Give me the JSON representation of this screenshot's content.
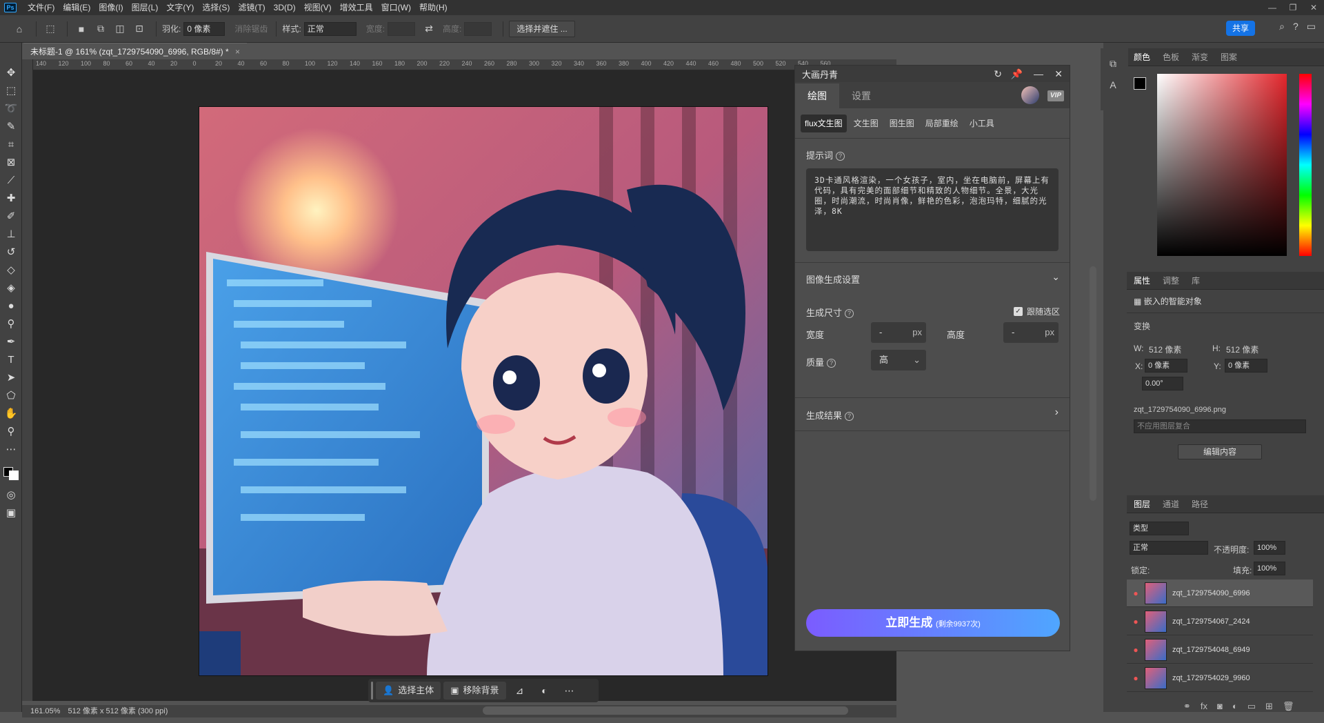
{
  "menubar": {
    "logo": "Ps",
    "items": [
      "文件(F)",
      "编辑(E)",
      "图像(I)",
      "图层(L)",
      "文字(Y)",
      "选择(S)",
      "滤镜(T)",
      "3D(D)",
      "视图(V)",
      "增效工具",
      "窗口(W)",
      "帮助(H)"
    ]
  },
  "options": {
    "feather_label": "羽化:",
    "feather_value": "0 像素",
    "antialias": "消除锯齿",
    "style_label": "样式:",
    "style_value": "正常",
    "width_label": "宽度:",
    "height_label": "高度:",
    "select_mask": "选择并遮住 ...",
    "share": "共享"
  },
  "document": {
    "tab_title": "未标题-1 @ 161% (zqt_1729754090_6996, RGB/8#) *",
    "ruler_ticks": [
      "140",
      "120",
      "100",
      "80",
      "60",
      "40",
      "20",
      "0",
      "20",
      "40",
      "60",
      "80",
      "100",
      "120",
      "140",
      "160",
      "180",
      "200",
      "220",
      "240",
      "260",
      "280",
      "300",
      "320",
      "340",
      "360",
      "380",
      "400",
      "420",
      "440",
      "460",
      "480",
      "500",
      "520",
      "540",
      "560"
    ]
  },
  "floating_bar": {
    "select_subject": "选择主体",
    "remove_bg": "移除背景"
  },
  "status": {
    "zoom": "161.05%",
    "info": "512 像素 x 512 像素 (300 ppi)"
  },
  "plugin": {
    "title": "大画丹青",
    "tabs": [
      "绘图",
      "设置"
    ],
    "vip": "VIP",
    "subtabs": [
      "flux文生图",
      "文生图",
      "图生图",
      "局部重绘",
      "小工具"
    ],
    "prompt_label": "提示词",
    "prompt_text": "3D卡通风格渲染，一个女孩子，室内，坐在电脑前，屏幕上有代码，具有完美的面部细节和精致的人物细节。全景，大光圈，时尚潮流，时尚肖像，鲜艳的色彩，泡泡玛特，细腻的光泽，8K",
    "image_settings": "图像生成设置",
    "size_label": "生成尺寸",
    "follow_selection": "跟随选区",
    "width_label": "宽度",
    "height_label": "高度",
    "width_value": "-",
    "height_value": "-",
    "unit": "px",
    "quality_label": "质量",
    "quality_value": "高",
    "results_label": "生成结果",
    "generate": "立即生成",
    "generate_remaining": "(剩余9937次)"
  },
  "right_panel": {
    "color_tabs": [
      "颜色",
      "色板",
      "渐变",
      "图案"
    ],
    "props_tabs": [
      "属性",
      "调整",
      "库"
    ],
    "smart_object": "嵌入的智能对象",
    "transform": "变换",
    "w_label": "W:",
    "w_value": "512 像素",
    "h_label": "H:",
    "h_value": "512 像素",
    "x_label": "X:",
    "x_value": "0 像素",
    "y_label": "Y:",
    "y_value": "0 像素",
    "angle": "0.00°",
    "filename": "zqt_1729754090_6996.png",
    "layer_comp": "不应用图层复合",
    "edit_contents": "编辑内容",
    "layer_tabs": [
      "图层",
      "通道",
      "路径"
    ],
    "kind": "类型",
    "blend": "正常",
    "opacity_label": "不透明度:",
    "opacity": "100%",
    "lock_label": "锁定:",
    "fill_label": "填充:",
    "fill": "100%",
    "layers": [
      "zqt_1729754090_6996",
      "zqt_1729754067_2424",
      "zqt_1729754048_6949",
      "zqt_1729754029_9960"
    ]
  }
}
